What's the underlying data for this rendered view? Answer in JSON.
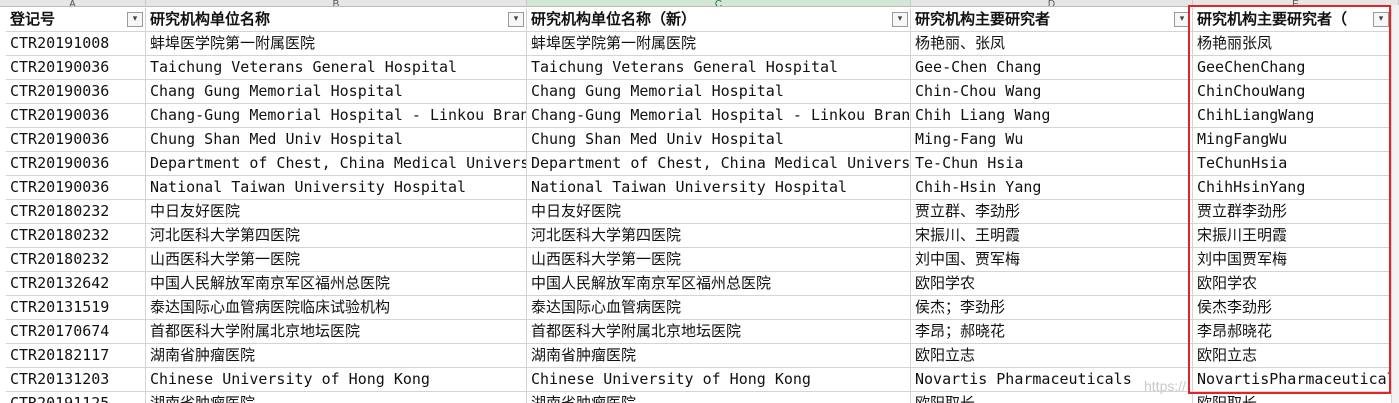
{
  "columns": [
    {
      "letter": "A",
      "header": "登记号"
    },
    {
      "letter": "B",
      "header": "研究机构单位名称"
    },
    {
      "letter": "C",
      "header": "研究机构单位名称（新）"
    },
    {
      "letter": "D",
      "header": "研究机构主要研究者"
    },
    {
      "letter": "E",
      "header": "研究机构主要研究者（"
    }
  ],
  "filter_icon": "chevron-down-icon",
  "rows": [
    [
      "CTR20191008",
      "蚌埠医学院第一附属医院",
      "蚌埠医学院第一附属医院",
      "杨艳丽、张凤",
      "杨艳丽张凤"
    ],
    [
      "CTR20190036",
      "Taichung Veterans General Hospital",
      "Taichung Veterans General Hospital",
      "Gee-Chen Chang",
      "GeeChenChang"
    ],
    [
      "CTR20190036",
      "Chang Gung Memorial Hospital",
      "Chang Gung Memorial Hospital",
      "Chin-Chou Wang",
      "ChinChouWang"
    ],
    [
      "CTR20190036",
      "Chang-Gung Memorial Hospital - Linkou Branch",
      "Chang-Gung Memorial Hospital - Linkou Branch",
      "Chih Liang Wang",
      "ChihLiangWang"
    ],
    [
      "CTR20190036",
      "Chung Shan Med Univ Hospital",
      "Chung Shan Med Univ Hospital",
      "Ming-Fang Wu",
      "MingFangWu"
    ],
    [
      "CTR20190036",
      "Department of Chest, China Medical University",
      "Department of Chest, China Medical University",
      "Te-Chun Hsia",
      "TeChunHsia"
    ],
    [
      "CTR20190036",
      "National Taiwan University Hospital",
      "National Taiwan University Hospital",
      "Chih-Hsin Yang",
      "ChihHsinYang"
    ],
    [
      "CTR20180232",
      "中日友好医院",
      "中日友好医院",
      "贾立群、李劲彤",
      "贾立群李劲彤"
    ],
    [
      "CTR20180232",
      "河北医科大学第四医院",
      "河北医科大学第四医院",
      "宋振川、王明霞",
      "宋振川王明霞"
    ],
    [
      "CTR20180232",
      "山西医科大学第一医院",
      "山西医科大学第一医院",
      "刘中国、贾军梅",
      "刘中国贾军梅"
    ],
    [
      "CTR20132642",
      "中国人民解放军南京军区福州总医院",
      "中国人民解放军南京军区福州总医院",
      "欧阳学农",
      "欧阳学农"
    ],
    [
      "CTR20131519",
      "泰达国际心血管病医院临床试验机构",
      "泰达国际心血管病医院",
      "侯杰；李劲彤",
      "侯杰李劲彤"
    ],
    [
      "CTR20170674",
      "首都医科大学附属北京地坛医院",
      "首都医科大学附属北京地坛医院",
      "李昂；郝晓花",
      "李昂郝晓花"
    ],
    [
      "CTR20182117",
      "湖南省肿瘤医院",
      "湖南省肿瘤医院",
      "欧阳立志",
      "欧阳立志"
    ],
    [
      "CTR20131203",
      "Chinese University of Hong Kong",
      "Chinese University of Hong Kong",
      "Novartis Pharmaceuticals",
      "NovartisPharmaceuticals"
    ],
    [
      "CTR20191125",
      "湖南省肿瘤医院",
      "湖南省肿瘤医院",
      "欧阳取长",
      "欧阳取长"
    ]
  ],
  "watermark": "https://"
}
